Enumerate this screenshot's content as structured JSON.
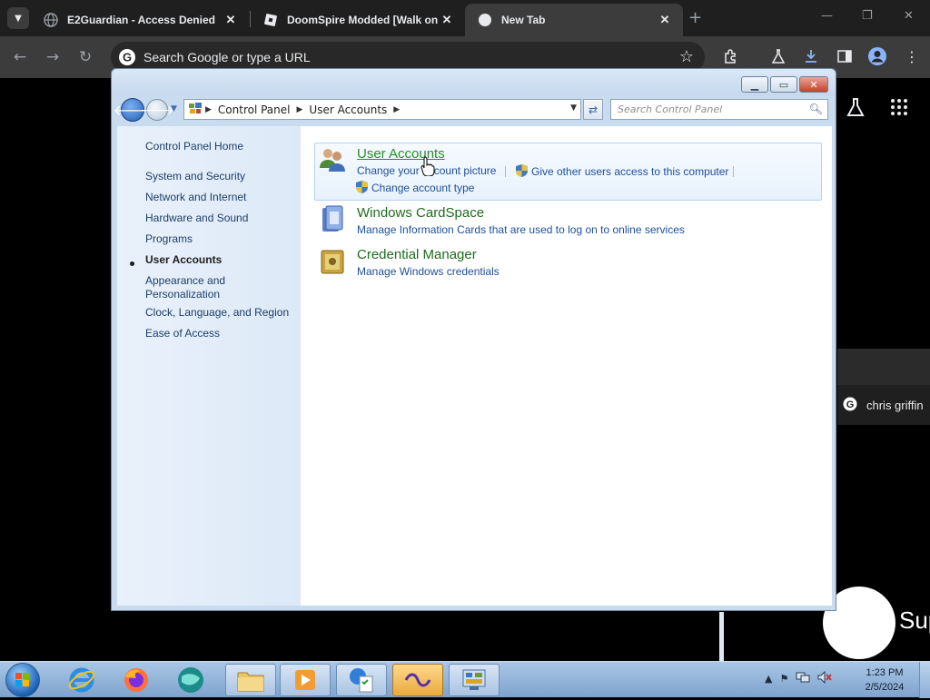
{
  "browser": {
    "tabs": [
      {
        "title": "E2Guardian - Access Denied",
        "active": false
      },
      {
        "title": "DoomSpire Modded [Walk on",
        "active": false
      },
      {
        "title": "New Tab",
        "active": true
      }
    ],
    "new_tab_glyph": "+",
    "omnibox_text": "Search Google or type a URL",
    "suggestion": "chris griffin",
    "partial_logo_text": "Sup"
  },
  "control_panel": {
    "breadcrumb": [
      "Control Panel",
      "User Accounts"
    ],
    "search_placeholder": "Search Control Panel",
    "nav": [
      "Control Panel Home",
      "System and Security",
      "Network and Internet",
      "Hardware and Sound",
      "Programs",
      "User Accounts",
      "Appearance and Personalization",
      "Clock, Language, and Region",
      "Ease of Access"
    ],
    "current_nav": "User Accounts",
    "categories": [
      {
        "title": "User Accounts",
        "icon": "users-icon",
        "links": [
          "Change your account picture",
          "Give other users access to this computer",
          "Change account type"
        ]
      },
      {
        "title": "Windows CardSpace",
        "icon": "cardspace-icon",
        "links": [
          "Manage Information Cards that are used to log on to online services"
        ]
      },
      {
        "title": "Credential Manager",
        "icon": "vault-icon",
        "links": [
          "Manage Windows credentials"
        ]
      }
    ]
  },
  "taskbar": {
    "time": "1:23 PM",
    "date": "2/5/2024"
  }
}
